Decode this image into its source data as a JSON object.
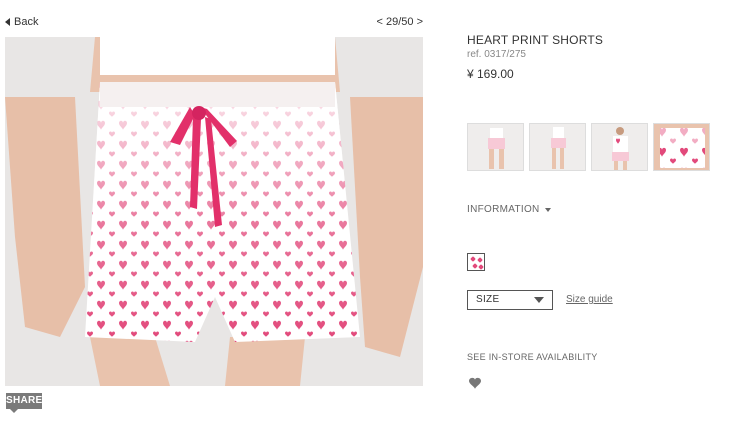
{
  "nav": {
    "back_label": "Back",
    "pager": "< 29/50 >"
  },
  "product": {
    "title": "HEART PRINT SHORTS",
    "ref": "ref. 0317/275",
    "price": "¥ 169.00"
  },
  "thumbnails": [
    {
      "name": "thumbnail-front"
    },
    {
      "name": "thumbnail-side"
    },
    {
      "name": "thumbnail-set"
    },
    {
      "name": "thumbnail-detail"
    }
  ],
  "info": {
    "label": "INFORMATION"
  },
  "size": {
    "selected": "SIZE",
    "guide_label": "Size guide"
  },
  "availability": {
    "label": "SEE IN-STORE AVAILABILITY"
  },
  "share": {
    "label": "SHARE"
  },
  "colors": {
    "accent_pink": "#e2497b",
    "share_bg": "#7a7a7a"
  },
  "icons": {
    "wishlist": "heart-icon",
    "back": "triangle-left-icon",
    "dropdown": "chevron-down-icon"
  }
}
